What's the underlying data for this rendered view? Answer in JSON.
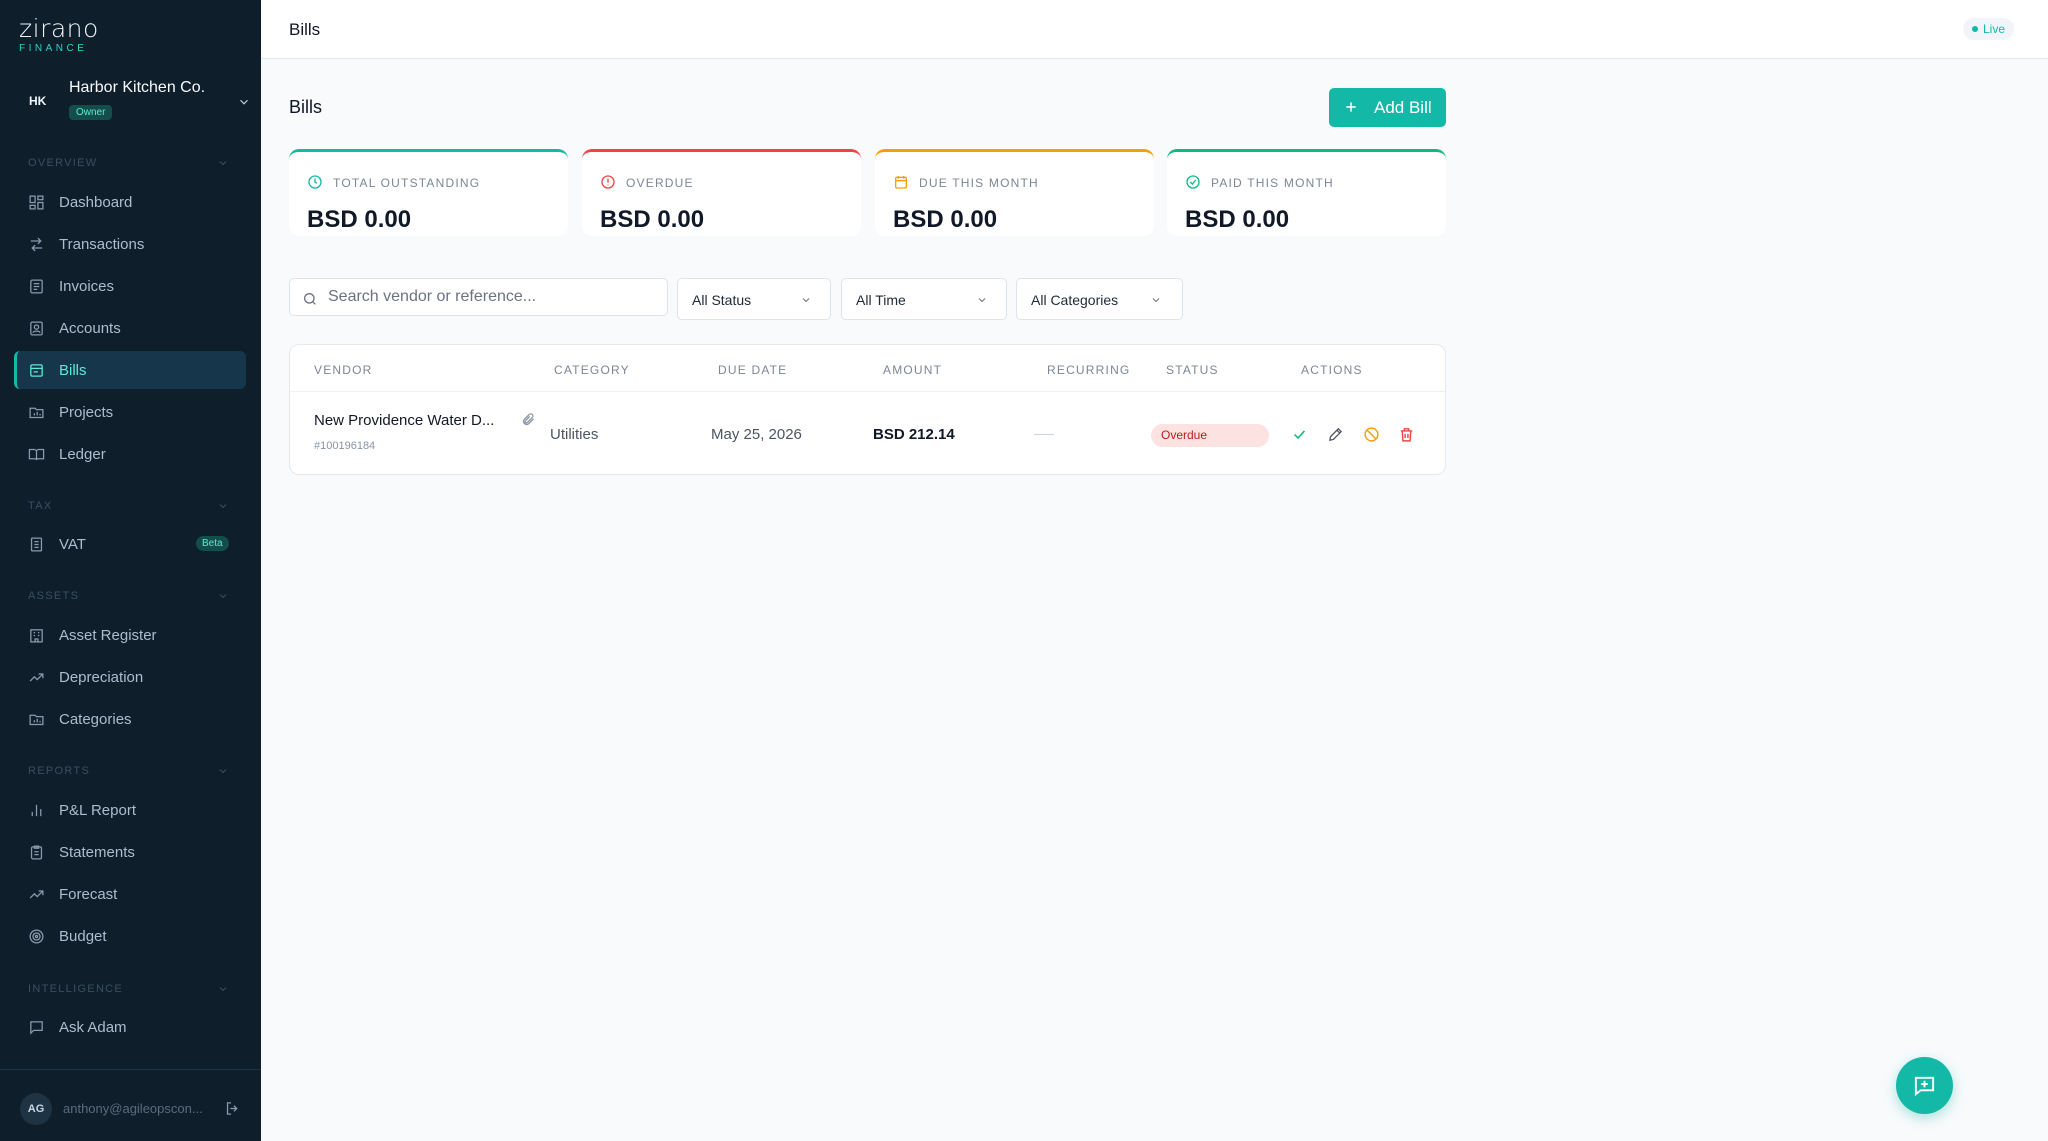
{
  "brand": {
    "name": "zirano",
    "tagline": "FINANCE"
  },
  "org": {
    "initials": "HK",
    "name": "Harbor Kitchen Co.",
    "role": "Owner"
  },
  "sidebar": {
    "sections": {
      "overview": "OVERVIEW",
      "tax": "TAX",
      "assets": "ASSETS",
      "reports": "REPORTS",
      "intelligence": "INTELLIGENCE"
    },
    "items": {
      "dashboard": "Dashboard",
      "transactions": "Transactions",
      "invoices": "Invoices",
      "accounts": "Accounts",
      "bills": "Bills",
      "projects": "Projects",
      "ledger": "Ledger",
      "vat": "VAT",
      "vat_badge": "Beta",
      "asset_register": "Asset Register",
      "depreciation": "Depreciation",
      "categories": "Categories",
      "pl_report": "P&L Report",
      "statements": "Statements",
      "forecast": "Forecast",
      "budget": "Budget",
      "ask_adam": "Ask Adam"
    },
    "active": "bills"
  },
  "user": {
    "initials": "AG",
    "email": "anthony@agileopscon..."
  },
  "header": {
    "title": "Bills",
    "live_label": "Live"
  },
  "page": {
    "title": "Bills",
    "add_button": "Add Bill"
  },
  "summary_cards": [
    {
      "label": "TOTAL OUTSTANDING",
      "value": "BSD 0.00",
      "color": "#14b8a6"
    },
    {
      "label": "OVERDUE",
      "value": "BSD 0.00",
      "color": "#ef4444"
    },
    {
      "label": "DUE THIS MONTH",
      "value": "BSD 0.00",
      "color": "#f59e0b"
    },
    {
      "label": "PAID THIS MONTH",
      "value": "BSD 0.00",
      "color": "#10b981"
    }
  ],
  "filters": {
    "search_placeholder": "Search vendor or reference...",
    "status": "All Status",
    "time": "All Time",
    "category": "All Categories"
  },
  "table": {
    "columns": [
      "VENDOR",
      "CATEGORY",
      "DUE DATE",
      "AMOUNT",
      "RECURRING",
      "STATUS",
      "ACTIONS"
    ],
    "rows": [
      {
        "vendor": "New Providence Water D...",
        "reference": "#100196184",
        "category": "Utilities",
        "due_date": "May 25, 2026",
        "amount": "BSD 212.14",
        "recurring": "",
        "status": "Overdue"
      }
    ]
  },
  "colors": {
    "accent": "#14b8a6",
    "sidebar_bg": "#0f1e2b",
    "danger": "#ef4444",
    "warning": "#f59e0b"
  }
}
